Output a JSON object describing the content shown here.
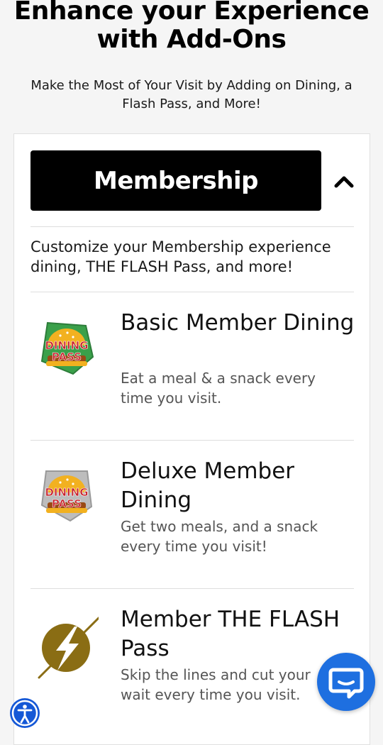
{
  "header": {
    "title": "Enhance your Experience with Add-Ons",
    "subtitle": "Make the Most of Your Visit by Adding on Dining, a Flash Pass, and More!"
  },
  "accordion": {
    "title": "Membership",
    "expanded": true,
    "intro": "Customize your Membership experience dining, THE FLASH Pass, and more!"
  },
  "addons": [
    {
      "title": "Basic Member Dining",
      "description": "Eat a meal & a snack every time you visit.",
      "icon": "dining-pass-icon",
      "icon_text_top": "DINING",
      "icon_text_bottom": "PASS",
      "icon_accent": "#3aa04a"
    },
    {
      "title": "Deluxe Member Dining",
      "description": "Get two meals, and a snack every time you visit!",
      "icon": "dining-pass-icon",
      "icon_text_top": "DINING",
      "icon_text_bottom": "PASS",
      "icon_accent": "#a9a9a9"
    },
    {
      "title": "Member THE FLASH Pass",
      "description": "Skip the lines and cut your wait every time you visit.",
      "icon": "flash-pass-icon"
    }
  ],
  "widgets": {
    "chat": "chat-icon",
    "accessibility": "accessibility-icon"
  },
  "colors": {
    "accordion_bg": "#000000",
    "chat_bg": "#1e6fe0",
    "accessibility_bg": "#1558d6",
    "flash_gold": "#8a6d14",
    "dining_red": "#c8202a",
    "dining_yellow": "#f2b120"
  }
}
